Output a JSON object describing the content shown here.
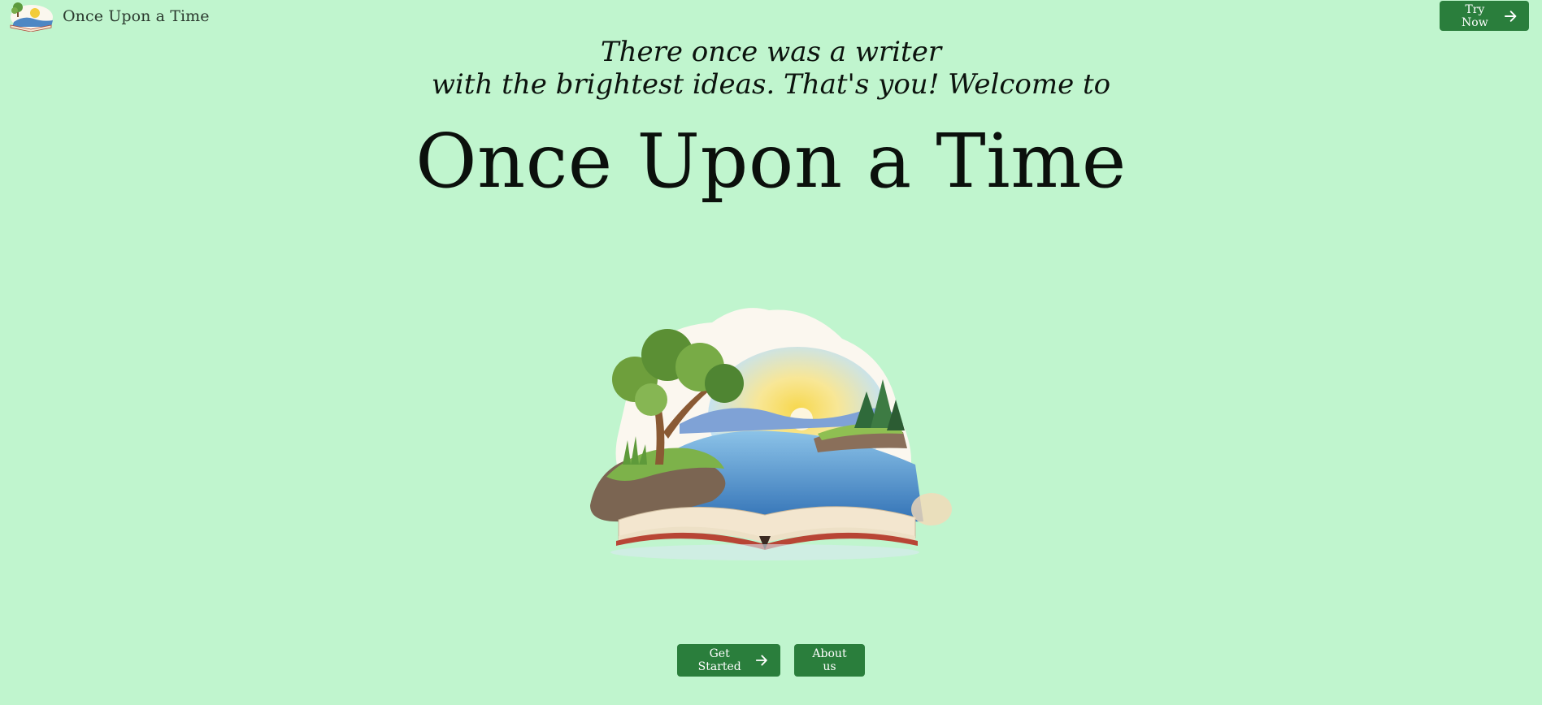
{
  "header": {
    "brand_name": "Once Upon a Time",
    "logo_icon": "book-landscape-logo-icon",
    "try_now_label": "Try Now",
    "try_now_icon": "arrow-right-icon"
  },
  "hero": {
    "tagline_line1": "There once was a writer",
    "tagline_line2": "with the brightest ideas. That's you! Welcome to",
    "title": "Once Upon a Time",
    "illustration_icon": "open-book-landscape-illustration"
  },
  "actions": {
    "get_started_label": "Get Started",
    "get_started_icon": "arrow-right-icon",
    "about_us_label": "About us"
  },
  "colors": {
    "background": "#c0f5ce",
    "button": "#2a7e3c",
    "button_text": "#ffffff",
    "text": "#0c130e"
  }
}
